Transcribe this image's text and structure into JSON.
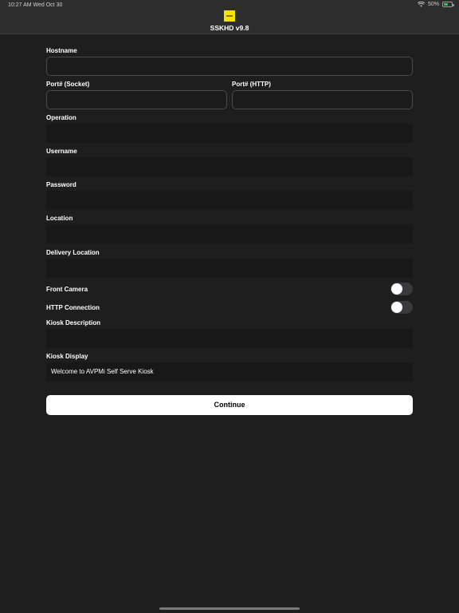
{
  "status_bar": {
    "time_date": "10:27 AM   Wed Oct 30",
    "wifi_icon": "wifi-icon",
    "battery_percent_text": "50%",
    "battery_level": 0.5,
    "battery_color": "#34c759"
  },
  "header": {
    "logo_icon": "app-logo-icon",
    "logo_color": "#f3e400",
    "title": "SSKHD v9.8"
  },
  "form": {
    "hostname": {
      "label": "Hostname",
      "value": ""
    },
    "port_socket": {
      "label": "Port# (Socket)",
      "value": ""
    },
    "port_http": {
      "label": "Port# (HTTP)",
      "value": ""
    },
    "operation": {
      "label": "Operation",
      "value": ""
    },
    "username": {
      "label": "Username",
      "value": ""
    },
    "password": {
      "label": "Password",
      "value": ""
    },
    "location": {
      "label": "Location",
      "value": ""
    },
    "delivery_location": {
      "label": "Delivery Location",
      "value": ""
    },
    "front_camera": {
      "label": "Front Camera",
      "on": false
    },
    "http_connection": {
      "label": "HTTP Connection",
      "on": false
    },
    "kiosk_description": {
      "label": "Kiosk Description",
      "value": ""
    },
    "kiosk_display": {
      "label": "Kiosk Display",
      "value": "Welcome to AVPMi Self Serve Kiosk"
    }
  },
  "actions": {
    "continue_label": "Continue"
  }
}
